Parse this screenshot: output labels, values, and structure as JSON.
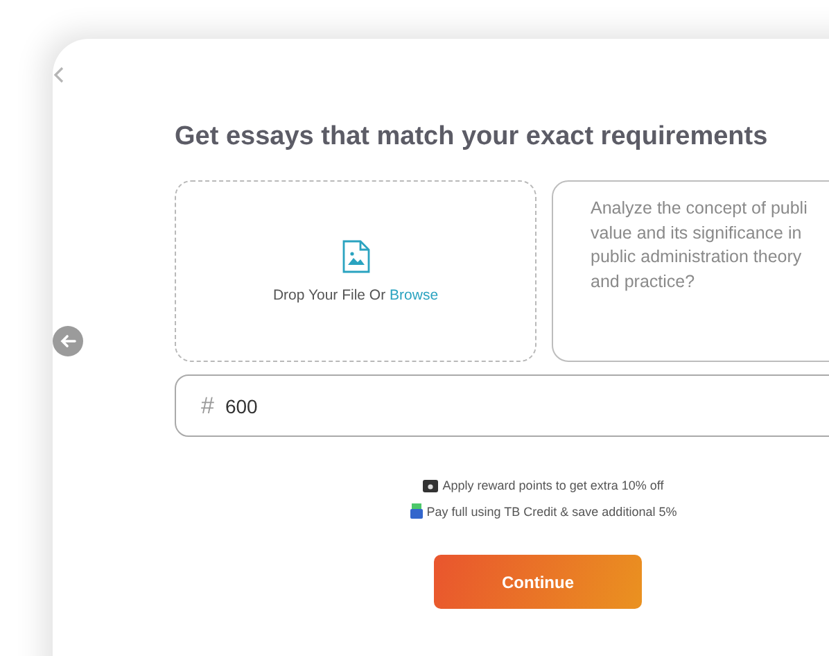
{
  "title": "Get essays that match your exact requirements",
  "upload": {
    "label": "Drop Your File Or ",
    "link": "Browse"
  },
  "question": {
    "value": "Analyze the concept of publi\nvalue and its significance in\npublic administration theory\nand practice?"
  },
  "word_count": {
    "symbol": "#",
    "value": "600"
  },
  "offers": [
    {
      "kind": "reward",
      "text": "Apply reward points to get extra 10% off"
    },
    {
      "kind": "credit",
      "text": "Pay full using TB Credit & save additional 5%"
    }
  ],
  "continue_button": "Continue"
}
